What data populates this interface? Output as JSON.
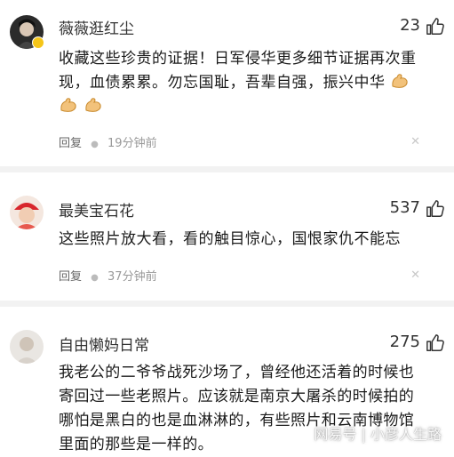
{
  "comments": [
    {
      "username": "薇薇逛红尘",
      "likes": "23",
      "text": "收藏这些珍贵的证据！日军侵华更多细节证据再次重现，血债累累。勿忘国耻，吾辈自强，振兴中华",
      "emoji": "flexed-biceps",
      "reply_label": "回复",
      "time": "19分钟前",
      "avatar_icon": "avatar-dark-portrait"
    },
    {
      "username": "最美宝石花",
      "likes": "537",
      "text": "这些照片放大看，看的触目惊心，国恨家仇不能忘",
      "reply_label": "回复",
      "time": "37分钟前",
      "avatar_icon": "avatar-red-cap-child"
    },
    {
      "username": "自由懒妈日常",
      "likes": "275",
      "lines": [
        "我老公的二爷爷战死沙场了，曾经他还活着的时候也",
        "寄回过一些老照片。应该就是南京大屠杀的时候拍的",
        "哪怕是黑白的也是血淋淋的，有些照片和云南博物馆",
        "里面的那些是一样的。"
      ],
      "avatar_icon": "avatar-light-portrait"
    }
  ],
  "watermark": "网易号 | 小彦人生路",
  "colors": {
    "divider": "#f2f2f2",
    "meta": "#999999",
    "text": "#1a1a1a"
  },
  "icons": {
    "like": "thumbs-up-icon",
    "dismiss": "close-icon",
    "emoji": "flexed-biceps-icon"
  }
}
